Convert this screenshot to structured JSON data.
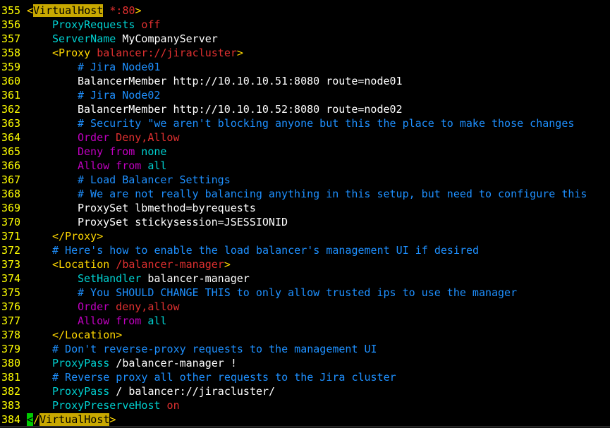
{
  "editor": {
    "lines": [
      {
        "n": "355",
        "indent": 0,
        "tokens": [
          [
            "<",
            "tag"
          ],
          [
            "VirtualHost",
            "hl"
          ],
          [
            " *:80",
            "val"
          ],
          [
            ">",
            "tag"
          ]
        ]
      },
      {
        "n": "356",
        "indent": 4,
        "tokens": [
          [
            "ProxyRequests",
            "dir"
          ],
          [
            " off",
            "val"
          ]
        ]
      },
      {
        "n": "357",
        "indent": 4,
        "tokens": [
          [
            "ServerName",
            "dir"
          ],
          [
            " MyCompanyServer",
            "plain"
          ]
        ]
      },
      {
        "n": "358",
        "indent": 4,
        "tokens": [
          [
            "<Proxy",
            "tag"
          ],
          [
            " balancer://jiracluster",
            "val"
          ],
          [
            ">",
            "tag"
          ]
        ]
      },
      {
        "n": "359",
        "indent": 8,
        "tokens": [
          [
            "# Jira Node01",
            "com"
          ]
        ]
      },
      {
        "n": "360",
        "indent": 8,
        "tokens": [
          [
            "BalancerMember http://10.10.10.51:8080 route=node01",
            "plain"
          ]
        ]
      },
      {
        "n": "361",
        "indent": 8,
        "tokens": [
          [
            "# Jira Node02",
            "com"
          ]
        ]
      },
      {
        "n": "362",
        "indent": 8,
        "tokens": [
          [
            "BalancerMember http://10.10.10.52:8080 route=node02",
            "plain"
          ]
        ]
      },
      {
        "n": "363",
        "indent": 8,
        "tokens": [
          [
            "# Security \"we aren't blocking anyone but this the place to make those changes",
            "com"
          ]
        ]
      },
      {
        "n": "364",
        "indent": 8,
        "tokens": [
          [
            "Order",
            "acc"
          ],
          [
            " Deny,Allow",
            "val"
          ]
        ]
      },
      {
        "n": "365",
        "indent": 8,
        "tokens": [
          [
            "Deny from",
            "acc"
          ],
          [
            " none",
            "dir"
          ]
        ]
      },
      {
        "n": "366",
        "indent": 8,
        "tokens": [
          [
            "Allow from",
            "acc"
          ],
          [
            " all",
            "dir"
          ]
        ]
      },
      {
        "n": "367",
        "indent": 8,
        "tokens": [
          [
            "# Load Balancer Settings",
            "com"
          ]
        ]
      },
      {
        "n": "368",
        "indent": 8,
        "tokens": [
          [
            "# We are not really balancing anything in this setup, but need to configure this",
            "com"
          ]
        ]
      },
      {
        "n": "369",
        "indent": 8,
        "tokens": [
          [
            "ProxySet lbmethod=byrequests",
            "plain"
          ]
        ]
      },
      {
        "n": "370",
        "indent": 8,
        "tokens": [
          [
            "ProxySet stickysession=JSESSIONID",
            "plain"
          ]
        ]
      },
      {
        "n": "371",
        "indent": 4,
        "tokens": [
          [
            "</Proxy>",
            "tag"
          ]
        ]
      },
      {
        "n": "372",
        "indent": 4,
        "tokens": [
          [
            "# Here's how to enable the load balancer's management UI if desired",
            "com"
          ]
        ]
      },
      {
        "n": "373",
        "indent": 4,
        "tokens": [
          [
            "<Location",
            "tag"
          ],
          [
            " /balancer-manager",
            "val"
          ],
          [
            ">",
            "tag"
          ]
        ]
      },
      {
        "n": "374",
        "indent": 8,
        "tokens": [
          [
            "SetHandler",
            "dir"
          ],
          [
            " balancer-manager",
            "plain"
          ]
        ]
      },
      {
        "n": "375",
        "indent": 8,
        "tokens": [
          [
            "# You SHOULD CHANGE THIS to only allow trusted ips to use the manager",
            "com"
          ]
        ]
      },
      {
        "n": "376",
        "indent": 8,
        "tokens": [
          [
            "Order",
            "acc"
          ],
          [
            " deny,allow",
            "val"
          ]
        ]
      },
      {
        "n": "377",
        "indent": 8,
        "tokens": [
          [
            "Allow from",
            "acc"
          ],
          [
            " all",
            "dir"
          ]
        ]
      },
      {
        "n": "378",
        "indent": 4,
        "tokens": [
          [
            "</Location>",
            "tag"
          ]
        ]
      },
      {
        "n": "379",
        "indent": 4,
        "tokens": [
          [
            "# Don't reverse-proxy requests to the management UI",
            "com"
          ]
        ]
      },
      {
        "n": "380",
        "indent": 4,
        "tokens": [
          [
            "ProxyPass",
            "dir"
          ],
          [
            " /balancer-manager !",
            "plain"
          ]
        ]
      },
      {
        "n": "381",
        "indent": 4,
        "tokens": [
          [
            "# Reverse proxy all other requests to the Jira cluster",
            "com"
          ]
        ]
      },
      {
        "n": "382",
        "indent": 4,
        "tokens": [
          [
            "ProxyPass",
            "dir"
          ],
          [
            " / balancer://jiracluster/",
            "plain"
          ]
        ]
      },
      {
        "n": "383",
        "indent": 4,
        "tokens": [
          [
            "ProxyPreserveHost",
            "dir"
          ],
          [
            " on",
            "val"
          ]
        ]
      },
      {
        "n": "384",
        "indent": 0,
        "tokens": [
          [
            "<",
            "cursor"
          ],
          [
            "/",
            "tag"
          ],
          [
            "VirtualHost",
            "hl"
          ],
          [
            ">",
            "tag"
          ]
        ]
      }
    ]
  },
  "colors": {
    "background": "#000000",
    "line_number": "#ffff00",
    "tag": "#ffd700",
    "directive": "#00d0d0",
    "value": "#e03030",
    "comment": "#1e90ff",
    "access": "#c000c0",
    "search_highlight": "#c8a800",
    "cursor": "#00cc00"
  }
}
